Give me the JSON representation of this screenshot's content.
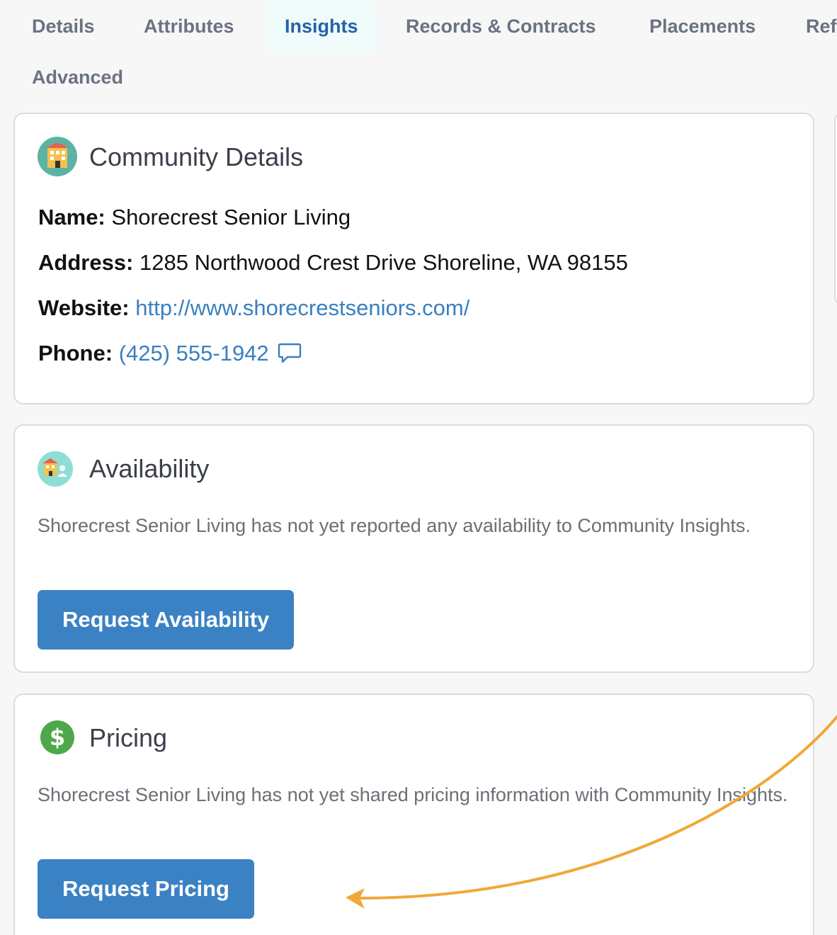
{
  "tabs": [
    {
      "label": "Details",
      "active": false
    },
    {
      "label": "Attributes",
      "active": false
    },
    {
      "label": "Insights",
      "active": true
    },
    {
      "label": "Records & Contracts",
      "active": false
    },
    {
      "label": "Placements",
      "active": false
    },
    {
      "label": "Ref",
      "active": false
    },
    {
      "label": "Advanced",
      "active": false
    }
  ],
  "community_details": {
    "title": "Community Details",
    "icon": "building-icon",
    "name_label": "Name:",
    "name_value": "Shorecrest Senior Living",
    "address_label": "Address:",
    "address_value": "1285 Northwood Crest Drive Shoreline, WA 98155",
    "website_label": "Website:",
    "website_value": "http://www.shorecrestseniors.com/",
    "phone_label": "Phone:",
    "phone_value": "(425) 555-1942",
    "phone_icon": "chat-bubble-icon"
  },
  "availability": {
    "title": "Availability",
    "icon": "building-person-icon",
    "description": "Shorecrest Senior Living has not yet reported any availability to Community Insights.",
    "button_label": "Request Availability"
  },
  "pricing": {
    "title": "Pricing",
    "icon": "dollar-icon",
    "description": "Shorecrest Senior Living has not yet shared pricing information with Community Insights.",
    "button_label": "Request Pricing"
  },
  "colors": {
    "accent": "#3b82c4",
    "active_tab": "#2563a8",
    "link": "#3a7fc0",
    "annotation_arrow": "#f0a836"
  }
}
